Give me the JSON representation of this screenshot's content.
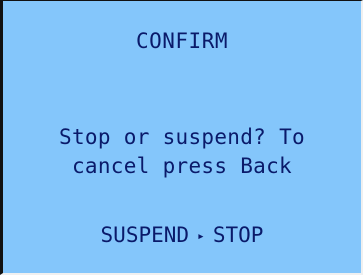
{
  "dialog": {
    "title": "CONFIRM",
    "message_line_1": "Stop or suspend? To",
    "message_line_2": "cancel press Back",
    "options": {
      "suspend_label": "SUSPEND",
      "selector_glyph": "▸",
      "stop_label": "STOP"
    }
  },
  "colors": {
    "background": "#84c6fb",
    "text": "#0a1a6a",
    "frame": "#111111"
  }
}
